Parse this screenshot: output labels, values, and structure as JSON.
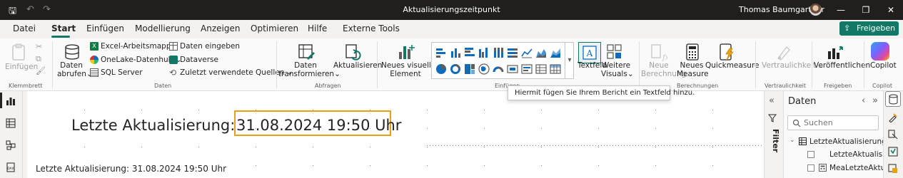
{
  "title_bar": {
    "title": "Aktualisierungszeitpunkt",
    "user_name": "Thomas Baumgartner"
  },
  "menu": {
    "items": [
      "Datei",
      "Start",
      "Einfügen",
      "Modellierung",
      "Anzeigen",
      "Optimieren",
      "Hilfe",
      "Externe Tools"
    ],
    "active": "Start",
    "share_label": "Freigeben"
  },
  "ribbon": {
    "clipboard": {
      "paste_label": "Einfügen",
      "group_label": "Klemmbrett"
    },
    "data": {
      "get_data_line1": "Daten",
      "get_data_line2": "abrufen",
      "excel": "Excel-Arbeitsmappe",
      "onelake": "OneLake-Datenhub",
      "sql": "SQL Server",
      "enter_data": "Daten eingeben",
      "dataverse": "Dataverse",
      "recent_sources": "Zuletzt verwendete Quellen",
      "group_label": "Daten"
    },
    "queries": {
      "transform_line1": "Daten",
      "transform_line2": "transformieren",
      "refresh": "Aktualisieren",
      "group_label": "Abfragen"
    },
    "insert": {
      "new_visual_line1": "Neues visuelles",
      "new_visual_line2": "Element",
      "textbox": "Textfeld",
      "more_visuals_line1": "Weitere",
      "more_visuals_line2": "Visuals",
      "group_label": "Einfügen"
    },
    "calculations": {
      "new_calc_line1": "Neue",
      "new_calc_line2": "Berechnung",
      "new_measure_line1": "Neues",
      "new_measure_line2": "Measure",
      "quick_measure": "Quickmeasure",
      "group_label": "Berechnungen"
    },
    "sensitivity": {
      "label": "Vertraulichkeit",
      "group_label": "Vertraulichkeit"
    },
    "share": {
      "publish": "Veröffentlichen",
      "group_label": "Freigeben"
    },
    "copilot": {
      "label": "Copilot",
      "group_label": "Copilot"
    }
  },
  "tooltip": "Hiermit fügen Sie Ihrem Bericht ein Textfeld hinzu.",
  "canvas": {
    "big_label": "Letzte Aktualisierung:",
    "big_value": "31.08.2024 19:50 Uhr",
    "small_line": "Letzte Aktualisierung: 31.08.2024 19:50 Uhr"
  },
  "filter_pane": {
    "label": "Filter"
  },
  "data_pane": {
    "title": "Daten",
    "search_placeholder": "Suchen",
    "table_name": "LetzteAktualisierung",
    "fields": [
      "LetzteAktualisie...",
      "MeaLetzteAktu..."
    ]
  },
  "colors": {
    "accent": "#117865",
    "selection_border": "#e8a014",
    "title_bar": "#201f1e"
  }
}
